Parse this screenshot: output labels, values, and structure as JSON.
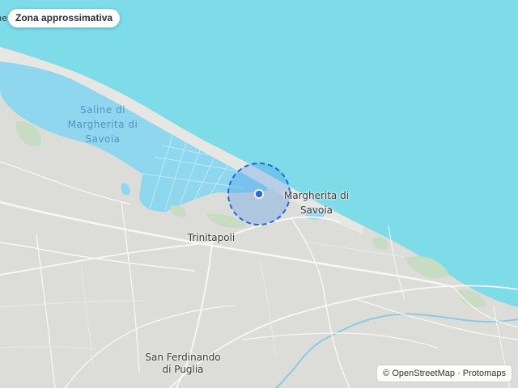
{
  "map": {
    "approx_badge": "Zona approssimativa",
    "edge_label": "ne",
    "water_label": [
      "Saline di",
      "Margherita di",
      "Savoia"
    ],
    "places": {
      "margherita": [
        "Margherita di",
        "Savoia"
      ],
      "trinitapoli": "Trinitapoli",
      "san_ferdinando": [
        "San Ferdinando",
        "di Puglia"
      ]
    },
    "attribution": {
      "symbol": "©",
      "osm": "OpenStreetMap",
      "sep": "·",
      "protomaps": "Protomaps"
    },
    "colors": {
      "sea": "#7ddce8",
      "land": "#dcdcd9",
      "saline": "#a9dcf1",
      "accuracy_fill": "#3d8ef0",
      "accuracy_stroke": "#2467d8",
      "location_dot": "#2a6bd4"
    },
    "location_accuracy": "approximate"
  }
}
